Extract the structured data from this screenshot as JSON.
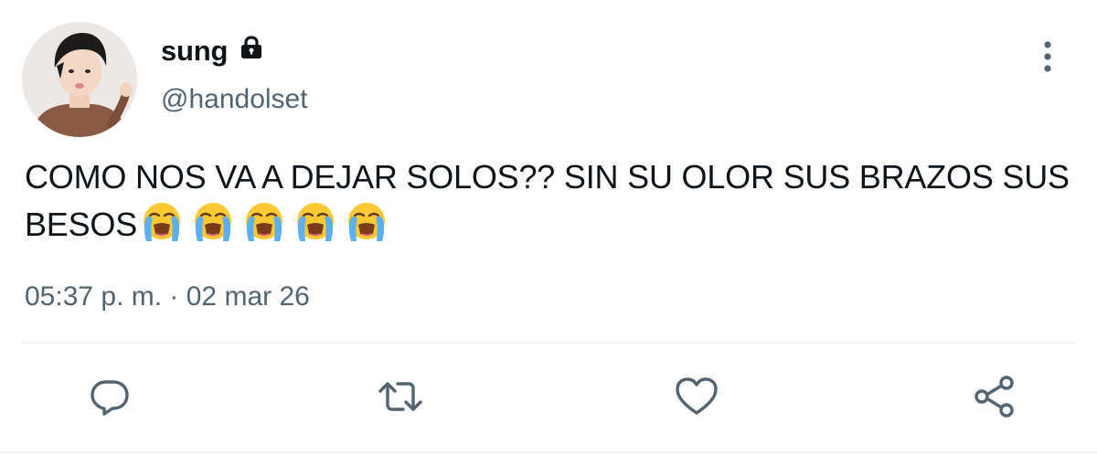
{
  "tweet": {
    "display_name": "sung",
    "handle": "@handolset",
    "text": "COMO NOS VA A DEJAR SOLOS?? SIN SU OLOR SUS BRAZOS SUS BESOS",
    "emojis": [
      "😭",
      "😭",
      "😭",
      "😭",
      "😭"
    ],
    "timestamp": "05:37 p. m. · 02 mar 26",
    "protected_account": true
  },
  "icons": {
    "lock": "lock-icon",
    "more": "more-vertical-icon",
    "reply": "reply-icon",
    "retweet": "retweet-icon",
    "like": "heart-icon",
    "share": "share-icon",
    "emoji": "loudly-crying-face-emoji"
  },
  "colors": {
    "text_primary": "#0f1419",
    "text_secondary": "#536471",
    "icon_gray": "#536471",
    "divider": "#eff3f4",
    "background": "#ffffff"
  }
}
